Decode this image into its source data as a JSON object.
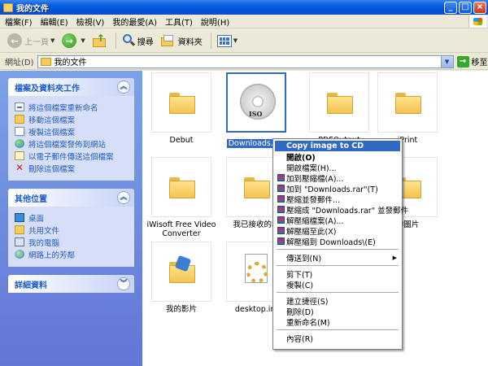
{
  "window": {
    "title": "我的文件",
    "icon": "folder-icon",
    "buttons": [
      "_",
      "□",
      "×"
    ]
  },
  "menubar": {
    "items": [
      "檔案(F)",
      "編輯(E)",
      "檢視(V)",
      "我的最愛(A)",
      "工具(T)",
      "說明(H)"
    ]
  },
  "toolbar": {
    "back_label": "上一頁",
    "search_label": "搜尋",
    "folders_label": "資料夾"
  },
  "address": {
    "label": "網址(D)",
    "value": "我的文件",
    "go_label": "移至"
  },
  "taskpane": {
    "file_tasks": {
      "title": "檔案及資料夾工作",
      "items": [
        "將這個檔案重新命名",
        "移動這個檔案",
        "複製這個檔案",
        "將這個檔案發佈到網站",
        "以電子郵件傳送這個檔案",
        "刪除這個檔案"
      ]
    },
    "other_places": {
      "title": "其他位置",
      "items": [
        "桌面",
        "共用文件",
        "我的電腦",
        "網路上的芳鄰"
      ]
    },
    "details": {
      "title": "詳細資料"
    }
  },
  "files": [
    {
      "name": "Debut",
      "type": "folder"
    },
    {
      "name": "Downloads.iso",
      "type": "iso",
      "label": "ISO"
    },
    {
      "name": "PDFOutput",
      "type": "folder"
    },
    {
      "name": "iPrint",
      "type": "folder"
    },
    {
      "name": "iWisoft Free Video Converter",
      "type": "folder"
    },
    {
      "name": "我已接收的檔",
      "type": "folder"
    },
    {
      "name": "的圖片",
      "type": "pictures"
    },
    {
      "name": "我的影片",
      "type": "videos"
    },
    {
      "name": "desktop.ini",
      "type": "ini"
    }
  ],
  "context_menu": {
    "items": [
      {
        "label": "Copy image to CD",
        "highlight": true
      },
      {
        "label": "開啟(O)",
        "bold": true
      },
      {
        "label": "開啟檔案(H)..."
      },
      {
        "label": "加到壓縮檔(A)...",
        "rar": true
      },
      {
        "label": "加到 \"Downloads.rar\"(T)",
        "rar": true
      },
      {
        "label": "壓縮並發郵件...",
        "rar": true
      },
      {
        "label": "壓縮成 \"Downloads.rar\" 並發郵件",
        "rar": true
      },
      {
        "label": "解壓縮檔案(A)...",
        "rar": true
      },
      {
        "label": "解壓縮至此(X)",
        "rar": true
      },
      {
        "label": "解壓縮到 Downloads\\(E)",
        "rar": true
      },
      {
        "separator": true
      },
      {
        "label": "傳送到(N)",
        "submenu": true
      },
      {
        "separator": true
      },
      {
        "label": "剪下(T)"
      },
      {
        "label": "複製(C)"
      },
      {
        "separator": true
      },
      {
        "label": "建立捷徑(S)"
      },
      {
        "label": "刪除(D)"
      },
      {
        "label": "重新命名(M)"
      },
      {
        "separator": true
      },
      {
        "label": "內容(R)"
      }
    ]
  },
  "colors": {
    "titlebar": "#0a5fe0",
    "selection": "#316ac5",
    "taskpane_link": "#215dc6"
  }
}
